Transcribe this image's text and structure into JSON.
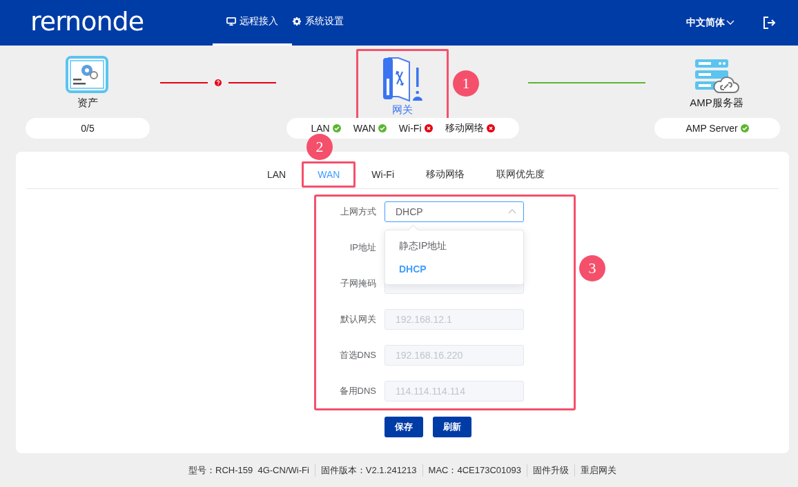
{
  "header": {
    "logo": "rernonde",
    "nav": [
      {
        "label": "远程接入",
        "selected": true
      },
      {
        "label": "系统设置",
        "selected": false
      }
    ],
    "language": "中文简体"
  },
  "topology": {
    "nodes": [
      {
        "name": "资产",
        "selected": false,
        "status": [
          {
            "text": "0/5"
          }
        ]
      },
      {
        "name": "网关",
        "selected": true,
        "status": [
          {
            "text": "LAN",
            "ok": true
          },
          {
            "text": "WAN",
            "ok": true
          },
          {
            "text": "Wi-Fi",
            "ok": false
          },
          {
            "text": "移动网络",
            "ok": false
          }
        ]
      },
      {
        "name": "AMP服务器",
        "selected": false,
        "status": [
          {
            "text": "AMP Server",
            "ok": true
          }
        ]
      }
    ],
    "links": [
      {
        "ok": false
      },
      {
        "ok": true
      }
    ]
  },
  "panel": {
    "tabs": [
      {
        "label": "LAN",
        "selected": false
      },
      {
        "label": "WAN",
        "selected": true
      },
      {
        "label": "Wi-Fi",
        "selected": false
      },
      {
        "label": "移动网络",
        "selected": false
      },
      {
        "label": "联网优先度",
        "selected": false
      }
    ],
    "fields": [
      {
        "kind": "select",
        "label": "上网方式",
        "value": "DHCP",
        "expanded": true,
        "options": [
          {
            "label": "静态IP地址",
            "selected": false
          },
          {
            "label": "DHCP",
            "selected": true
          }
        ]
      },
      {
        "kind": "covered",
        "label": "IP地址"
      },
      {
        "kind": "input",
        "label": "子网掩码",
        "disabled": true
      },
      {
        "kind": "input",
        "label": "默认网关",
        "value": "192.168.12.1",
        "disabled": true
      },
      {
        "kind": "input",
        "label": "首选DNS",
        "value": "192.168.16.220",
        "disabled": true
      },
      {
        "kind": "input",
        "label": "备用DNS",
        "value": "114.114.114.114",
        "disabled": true
      }
    ],
    "buttons": [
      "保存",
      "刷新"
    ]
  },
  "footer": [
    "型号：RCH-159  4G-CN/Wi-Fi",
    "固件版本：V2.1.241213",
    "MAC：4CE173C01093",
    "固件升级",
    "重启网关"
  ],
  "annotations": [
    {
      "label": "1"
    },
    {
      "label": "2"
    },
    {
      "label": "3"
    }
  ]
}
